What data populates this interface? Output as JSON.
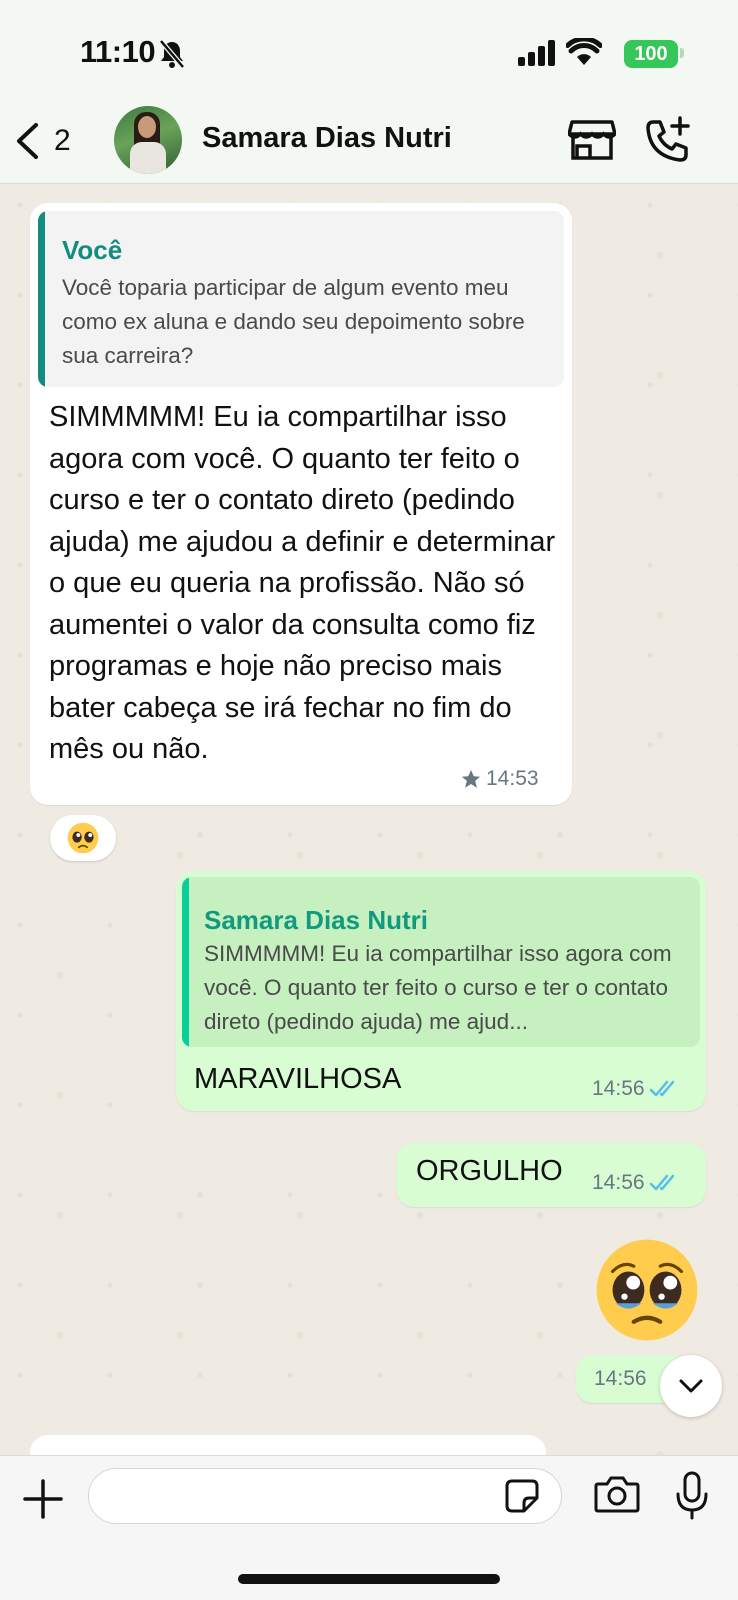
{
  "status_bar": {
    "time": "11:10",
    "battery": "100"
  },
  "header": {
    "back_count": "2",
    "contact_name": "Samara Dias Nutri"
  },
  "messages": [
    {
      "direction": "incoming",
      "quote": {
        "author": "Você",
        "text": "Você toparia participar de algum evento meu como ex aluna e dando seu depoimento sobre sua carreira?"
      },
      "text": "SIMMMMM! Eu ia compartilhar isso agora com você. O quanto ter feito o curso e ter o contato direto (pedindo ajuda) me ajudou a definir e determinar o que eu queria na profissão. Não só aumentei o valor da consulta como fiz programas e hoje não preciso mais bater cabeça se irá fechar no fim do mês ou não.",
      "time": "14:53",
      "starred": true,
      "reaction": "🥹"
    },
    {
      "direction": "outgoing",
      "quote": {
        "author": "Samara Dias Nutri",
        "text": "SIMMMMM! Eu ia compartilhar isso agora com você. O quanto ter feito o curso e ter o contato direto (pedindo ajuda) me ajud..."
      },
      "text": "MARAVILHOSA",
      "time": "14:56",
      "status": "read"
    },
    {
      "direction": "outgoing",
      "text": "ORGULHO",
      "time": "14:56",
      "status": "read"
    },
    {
      "direction": "outgoing",
      "emoji": "🥹",
      "time": "14:56"
    }
  ],
  "colors": {
    "you_accent": "#128c7e",
    "contact_accent": "#06cf9c",
    "outgoing_bg": "#d9fdd3",
    "read_tick": "#53bdeb"
  },
  "icons": [
    "chevron-left-icon",
    "store-icon",
    "call-add-icon",
    "star-icon",
    "double-check-icon",
    "chevron-down-icon",
    "plus-icon",
    "sticker-icon",
    "camera-icon",
    "mic-icon"
  ]
}
